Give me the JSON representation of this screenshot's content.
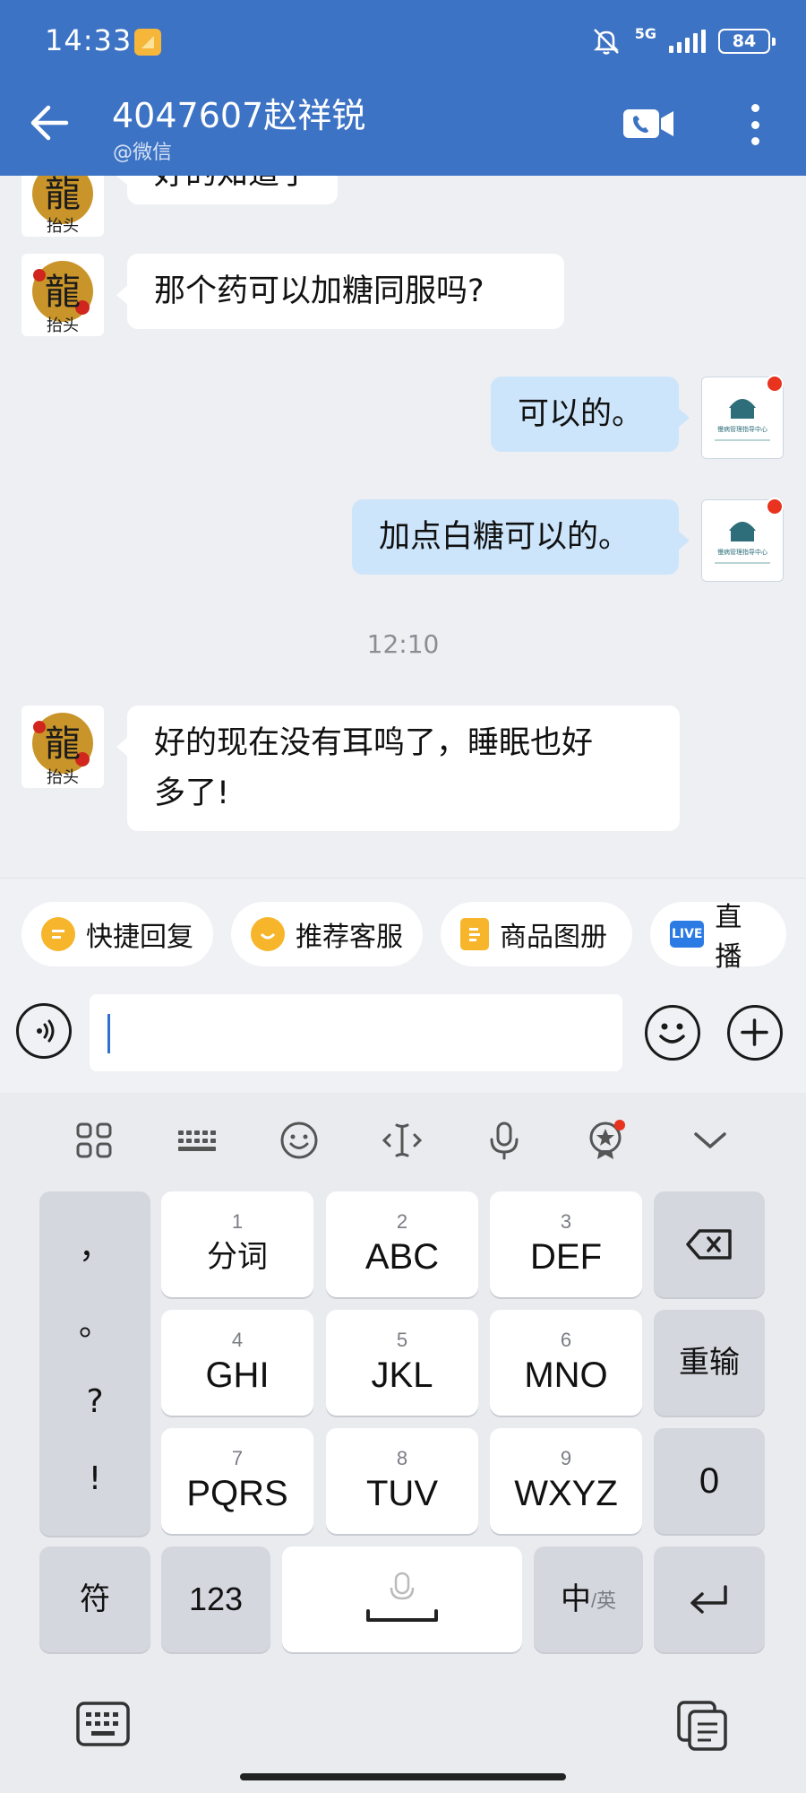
{
  "status_bar": {
    "time": "14:33",
    "network": "5G",
    "battery": "84"
  },
  "header": {
    "title": "4047607赵祥锐",
    "subtitle": "@微信"
  },
  "messages": {
    "m0": "好的知道了",
    "m1": "那个药可以加糖同服吗?",
    "m2": "可以的。",
    "m3": "加点白糖可以的。",
    "timestamp": "12:10",
    "m4_line1": "好的现在没有耳鸣了，睡眠也好",
    "m4_line2": "多了!"
  },
  "avatars": {
    "customer_text": "抬头",
    "customer_char": "龍",
    "agent_text": "慢病管理指导中心"
  },
  "quick_actions": [
    {
      "label": "快捷回复",
      "icon": "quick-reply-icon"
    },
    {
      "label": "推荐客服",
      "icon": "recommend-service-icon"
    },
    {
      "label": "商品图册",
      "icon": "product-album-icon"
    },
    {
      "label": "直播",
      "icon": "live-icon",
      "badge": "LIVE"
    }
  ],
  "input": {
    "value": ""
  },
  "keyboard": {
    "punctuation": [
      "，",
      "。",
      "?",
      "!"
    ],
    "keys": [
      {
        "num": "1",
        "label": "分词"
      },
      {
        "num": "2",
        "label": "ABC"
      },
      {
        "num": "3",
        "label": "DEF"
      },
      {
        "num": "4",
        "label": "GHI"
      },
      {
        "num": "5",
        "label": "JKL"
      },
      {
        "num": "6",
        "label": "MNO"
      },
      {
        "num": "7",
        "label": "PQRS"
      },
      {
        "num": "8",
        "label": "TUV"
      },
      {
        "num": "9",
        "label": "WXYZ"
      }
    ],
    "retype": "重输",
    "zero": "0",
    "symbols": "符",
    "numbers": "123",
    "lang_main": "中",
    "lang_alt": "/英"
  },
  "colors": {
    "header": "#3d73c4",
    "bubble_out": "#cde5fb",
    "bubble_in": "#ffffff",
    "background": "#eeeff3"
  }
}
